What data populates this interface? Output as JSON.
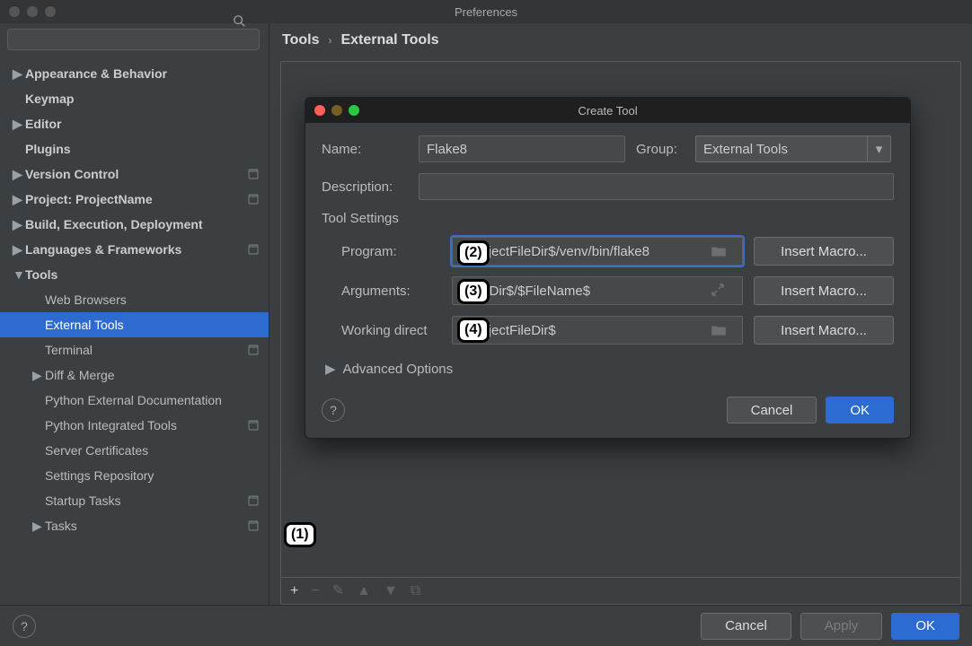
{
  "window": {
    "title": "Preferences"
  },
  "search": {
    "placeholder": ""
  },
  "sidebar": {
    "items": [
      {
        "label": "Appearance & Behavior",
        "arrow": "▶",
        "bold": true
      },
      {
        "label": "Keymap",
        "arrow": "",
        "bold": true
      },
      {
        "label": "Editor",
        "arrow": "▶",
        "bold": true
      },
      {
        "label": "Plugins",
        "arrow": "",
        "bold": true
      },
      {
        "label": "Version Control",
        "arrow": "▶",
        "bold": true,
        "projIcon": true
      },
      {
        "label": "Project: ProjectName",
        "arrow": "▶",
        "bold": true,
        "projIcon": true
      },
      {
        "label": "Build, Execution, Deployment",
        "arrow": "▶",
        "bold": true
      },
      {
        "label": "Languages & Frameworks",
        "arrow": "▶",
        "bold": true,
        "projIcon": true
      },
      {
        "label": "Tools",
        "arrow": "▼",
        "bold": true
      },
      {
        "label": "Web Browsers",
        "arrow": "",
        "level": 1
      },
      {
        "label": "External Tools",
        "arrow": "",
        "level": 1,
        "selected": true
      },
      {
        "label": "Terminal",
        "arrow": "",
        "level": 1,
        "projIcon": true
      },
      {
        "label": "Diff & Merge",
        "arrow": "▶",
        "level": 1
      },
      {
        "label": "Python External Documentation",
        "arrow": "",
        "level": 1
      },
      {
        "label": "Python Integrated Tools",
        "arrow": "",
        "level": 1,
        "projIcon": true
      },
      {
        "label": "Server Certificates",
        "arrow": "",
        "level": 1
      },
      {
        "label": "Settings Repository",
        "arrow": "",
        "level": 1
      },
      {
        "label": "Startup Tasks",
        "arrow": "",
        "level": 1,
        "projIcon": true
      },
      {
        "label": "Tasks",
        "arrow": "▶",
        "level": 1,
        "projIcon": true
      }
    ]
  },
  "breadcrumb": {
    "root": "Tools",
    "leaf": "External Tools",
    "sep": "›"
  },
  "modal": {
    "title": "Create Tool",
    "labels": {
      "name": "Name:",
      "group": "Group:",
      "description": "Description:",
      "section": "Tool Settings",
      "program": "Program:",
      "arguments": "Arguments:",
      "workdir": "Working direct",
      "advanced": "Advanced Options"
    },
    "values": {
      "name": "Flake8",
      "group": "External Tools",
      "description": "",
      "program": "$ProjectFileDir$/venv/bin/flake8",
      "arguments": "$FileDir$/$FileName$",
      "workdir": "$ProjectFileDir$"
    },
    "macroBtn": "Insert Macro...",
    "cancel": "Cancel",
    "ok": "OK"
  },
  "toolbar": {
    "add": "+",
    "remove": "−",
    "edit": "✎",
    "up": "▲",
    "down": "▼",
    "copy": "⧉"
  },
  "callouts": {
    "c1": "(1)",
    "c2": "(2)",
    "c3": "(3)",
    "c4": "(4)"
  },
  "bottom": {
    "cancel": "Cancel",
    "apply": "Apply",
    "ok": "OK",
    "help": "?"
  }
}
